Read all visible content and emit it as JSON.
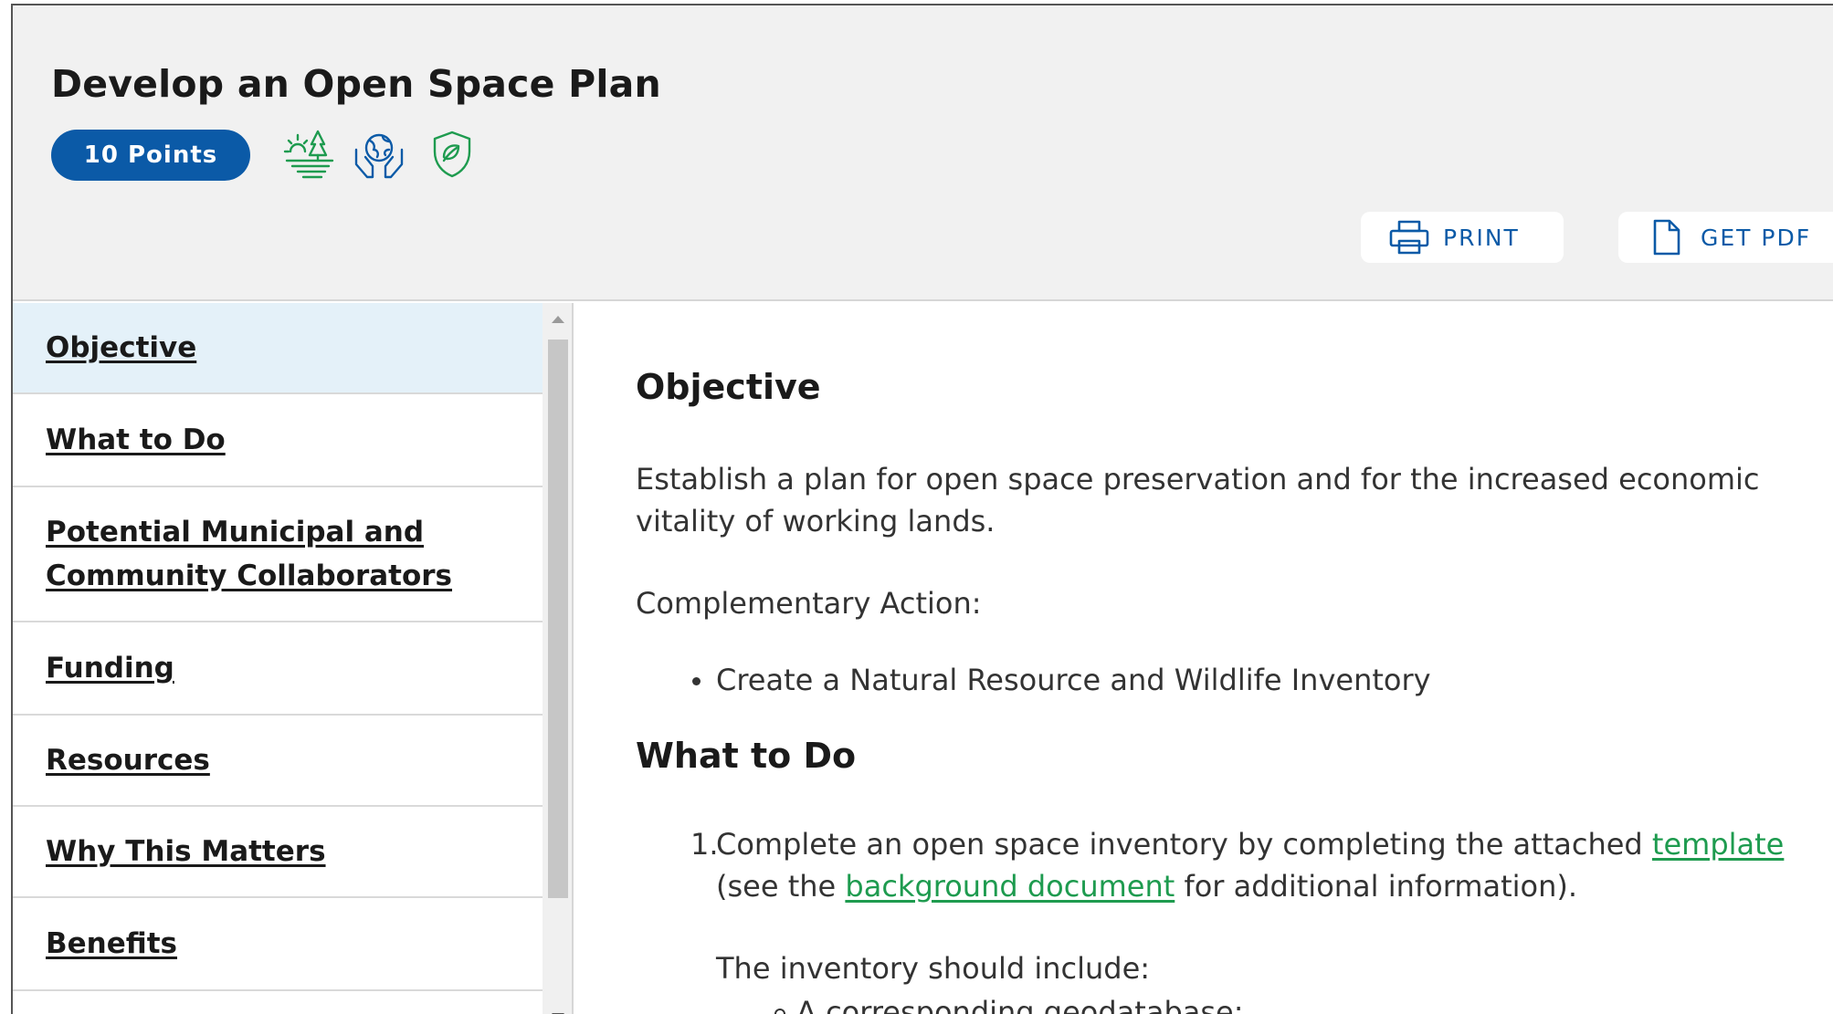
{
  "page": {
    "title": "Develop an Open Space Plan",
    "points_badge": "10 Points",
    "category_icons": [
      "landscape-sun-trees-icon",
      "globe-in-hands-icon",
      "shield-leaf-icon"
    ],
    "accent_color": "#0b5aa7",
    "icon_color": "#1e9b4f"
  },
  "actions": {
    "print_label": "PRINT",
    "get_pdf_label": "GET PDF"
  },
  "sidebar": {
    "items": [
      {
        "label": "Objective",
        "active": true
      },
      {
        "label": "What to Do",
        "active": false
      },
      {
        "label": "Potential Municipal and",
        "label2": "Community Collaborators",
        "active": false
      },
      {
        "label": "Funding",
        "active": false
      },
      {
        "label": "Resources",
        "active": false
      },
      {
        "label": "Why This Matters",
        "active": false
      },
      {
        "label": "Benefits",
        "active": false
      }
    ]
  },
  "content": {
    "objective_heading": "Objective",
    "objective_text_1": "Establish a plan for open space preservation and for the increased economic",
    "objective_text_2": "vitality of working lands.",
    "complementary_label": "Complementary Action:",
    "complementary_item": "Create a Natural Resource and Wildlife Inventory",
    "what_to_do_heading": "What to Do",
    "step1_number": "1.",
    "step1_text_a": "Complete an open space inventory by completing the attached ",
    "step1_link_template": "template",
    "step1_text_b": "(see the ",
    "step1_link_background": "background document",
    "step1_text_c": " for additional information).",
    "inventory_intro": "The inventory should include:",
    "inventory_item_1": "A corresponding geodatabase;"
  }
}
